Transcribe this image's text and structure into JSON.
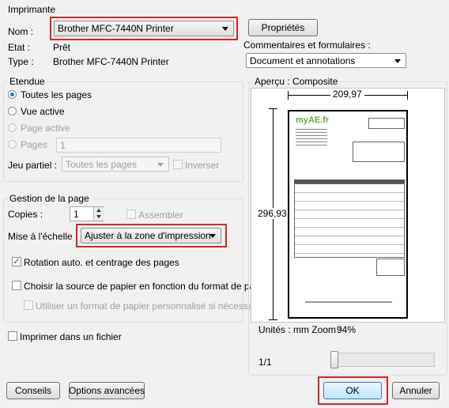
{
  "printer": {
    "group_title": "Imprimante",
    "name_label": "Nom :",
    "name_value": "Brother MFC-7440N Printer",
    "properties_button": "Propriétés",
    "state_label": "Etat :",
    "state_value": "Prêt",
    "type_label": "Type :",
    "type_value": "Brother MFC-7440N Printer",
    "comments_label": "Commentaires et formulaires :",
    "comments_value": "Document et annotations"
  },
  "range": {
    "group_title": "Etendue",
    "all_pages": "Toutes les pages",
    "current_view": "Vue active",
    "current_page": "Page active",
    "pages": "Pages",
    "pages_value": "1",
    "subset_label": "Jeu partiel :",
    "subset_value": "Toutes les pages",
    "reverse": "Inverser"
  },
  "handling": {
    "group_title": "Gestion de la page",
    "copies_label": "Copies :",
    "copies_value": "1",
    "collate": "Assembler",
    "scaling_label": "Mise à l'échelle :",
    "scaling_value": "Ajuster à la zone d'impression",
    "auto_rotate": "Rotation auto. et centrage des pages",
    "choose_paper": "Choisir la source de papier en fonction du format de page",
    "custom_paper": "Utiliser un format de papier personnalisé si nécessaire"
  },
  "print_to_file": "Imprimer dans un fichier",
  "preview": {
    "title": "Aperçu : Composite",
    "width_value": "209,97",
    "height_value": "296,93",
    "units_text": "Unités : mm Zoom :",
    "zoom_value": "94%",
    "page_counter": "1/1",
    "doc_logo": "myAE.fr"
  },
  "footer": {
    "advice_button": "Conseils",
    "advanced_button": "Options avancées",
    "ok_button": "OK",
    "cancel_button": "Annuler"
  },
  "colors": {
    "highlight": "#d8232a",
    "logo_green": "#6aa83a"
  }
}
